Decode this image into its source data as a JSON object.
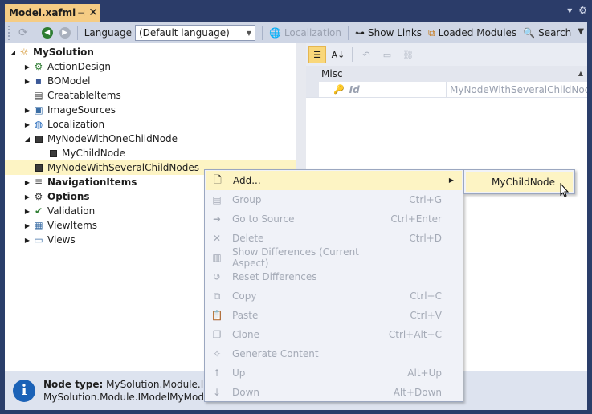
{
  "document_tab": {
    "title": "Model.xafml",
    "pin": "⊣",
    "close": "✕"
  },
  "toolbar": {
    "language_label": "Language",
    "language_value": "(Default language)",
    "localization_label": "Localization",
    "show_links_label": "Show Links",
    "loaded_modules_label": "Loaded Modules",
    "search_label": "Search"
  },
  "tree": {
    "items": [
      {
        "label": "MySolution",
        "bold": true,
        "icon": "solution-gear-icon",
        "level": 0,
        "expander": "◢"
      },
      {
        "label": "ActionDesign",
        "bold": false,
        "icon": "action-design-icon",
        "level": 1,
        "expander": "▶"
      },
      {
        "label": "BOModel",
        "bold": false,
        "icon": "bo-model-icon",
        "level": 1,
        "expander": "▶"
      },
      {
        "label": "CreatableItems",
        "bold": false,
        "icon": "creatable-items-icon",
        "level": 1,
        "expander": ""
      },
      {
        "label": "ImageSources",
        "bold": false,
        "icon": "image-sources-icon",
        "level": 1,
        "expander": "▶"
      },
      {
        "label": "Localization",
        "bold": false,
        "icon": "globe-icon",
        "level": 1,
        "expander": "▶"
      },
      {
        "label": "MyNodeWithOneChildNode",
        "bold": false,
        "icon": "node-icon",
        "level": 1,
        "expander": "◢"
      },
      {
        "label": "MyChildNode",
        "bold": false,
        "icon": "node-icon",
        "level": 2,
        "expander": ""
      },
      {
        "label": "MyNodeWithSeveralChildNodes",
        "bold": false,
        "icon": "node-icon",
        "level": 1,
        "expander": ""
      },
      {
        "label": "NavigationItems",
        "bold": true,
        "icon": "navigation-items-icon",
        "level": 1,
        "expander": "▶"
      },
      {
        "label": "Options",
        "bold": true,
        "icon": "options-gear-icon",
        "level": 1,
        "expander": "▶"
      },
      {
        "label": "Validation",
        "bold": false,
        "icon": "checkmark-icon",
        "level": 1,
        "expander": "▶"
      },
      {
        "label": "ViewItems",
        "bold": false,
        "icon": "view-items-icon",
        "level": 1,
        "expander": "▶"
      },
      {
        "label": "Views",
        "bold": false,
        "icon": "views-icon",
        "level": 1,
        "expander": "▶"
      }
    ]
  },
  "properties": {
    "category": "Misc",
    "rows": [
      {
        "name": "Id",
        "value": "MyNodeWithSeveralChildNod..."
      }
    ]
  },
  "infobar": {
    "node_type_label": "Node type:",
    "node_type_value": "MySolution.Module.IMod",
    "line2": "MySolution.Module.IModelMyModelE"
  },
  "context_menu": {
    "items": [
      {
        "label": "Add...",
        "shortcut": "",
        "enabled": true,
        "submenu": true,
        "icon": "new-page-icon"
      },
      {
        "label": "Group",
        "shortcut": "Ctrl+G",
        "enabled": false,
        "icon": "group-icon"
      },
      {
        "label": "Go to Source",
        "shortcut": "Ctrl+Enter",
        "enabled": false,
        "icon": "arrow-right-icon"
      },
      {
        "label": "Delete",
        "shortcut": "Ctrl+D",
        "enabled": false,
        "icon": "delete-x-icon"
      },
      {
        "label": "Show Differences (Current Aspect)",
        "shortcut": "",
        "enabled": false,
        "icon": "differences-icon"
      },
      {
        "label": "Reset Differences",
        "shortcut": "",
        "enabled": false,
        "icon": "reset-icon"
      },
      {
        "label": "Copy",
        "shortcut": "Ctrl+C",
        "enabled": false,
        "icon": "copy-icon"
      },
      {
        "label": "Paste",
        "shortcut": "Ctrl+V",
        "enabled": false,
        "icon": "paste-icon"
      },
      {
        "label": "Clone",
        "shortcut": "Ctrl+Alt+C",
        "enabled": false,
        "icon": "clone-icon"
      },
      {
        "label": "Generate Content",
        "shortcut": "",
        "enabled": false,
        "icon": "generate-icon"
      },
      {
        "label": "Up",
        "shortcut": "Alt+Up",
        "enabled": false,
        "icon": "arrow-up-icon"
      },
      {
        "label": "Down",
        "shortcut": "Alt+Down",
        "enabled": false,
        "icon": "arrow-down-icon"
      }
    ]
  },
  "submenu": {
    "items": [
      {
        "label": "MyChildNode"
      }
    ]
  },
  "colors": {
    "tab_active": "#f5cc84",
    "frame": "#2b3c69",
    "selection": "#fdf4c4",
    "info_icon": "#1b62b7"
  }
}
